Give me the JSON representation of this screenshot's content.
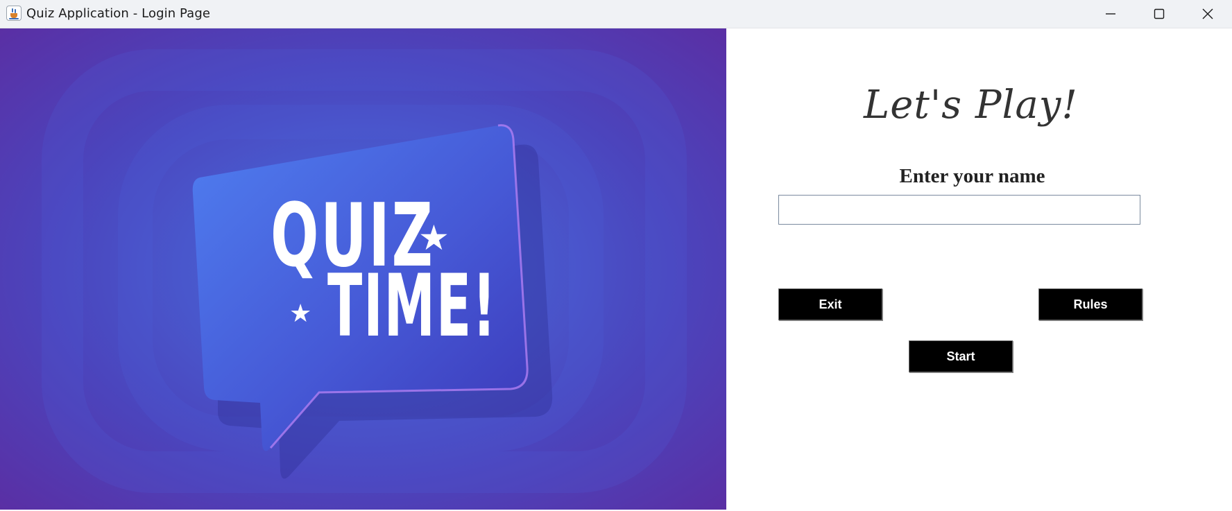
{
  "window": {
    "title": "Quiz Application - Login Page",
    "controls": [
      "minimize-icon",
      "maximize-icon",
      "close-icon"
    ]
  },
  "hero": {
    "line1": "QUIZ",
    "line2": "TIME!",
    "colors": {
      "background": "#4b45bd",
      "bubble": "#4a63d8",
      "edge": "#8f5ce0"
    }
  },
  "login": {
    "heading": "Let's Play!",
    "name_label": "Enter your name",
    "name_value": "",
    "exit_label": "Exit",
    "rules_label": "Rules",
    "start_label": "Start"
  }
}
